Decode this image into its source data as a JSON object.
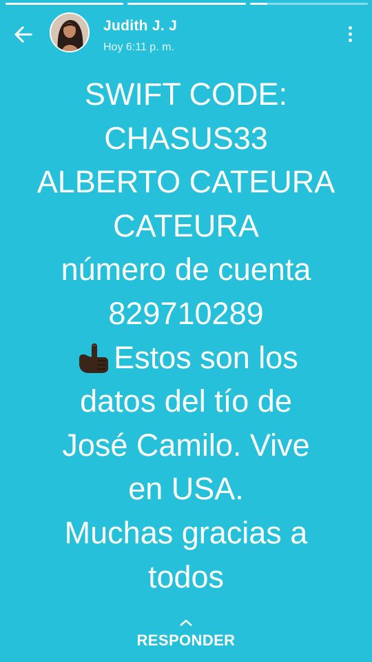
{
  "progress": {
    "segments": [
      1.0,
      1.0,
      0.15
    ]
  },
  "header": {
    "name": "Judith J. J",
    "time": "Hoy 6:11 p. m."
  },
  "message": {
    "lines": [
      "SWIFT CODE:",
      "CHASUS33",
      "ALBERTO CATEURA",
      "CATEURA",
      "número de cuenta",
      "829710289",
      "Estos son los",
      "datos del tío de",
      "José Camilo. Vive",
      "en USA.",
      "Muchas gracias a",
      "todos"
    ]
  },
  "footer": {
    "reply_label": "RESPONDER"
  },
  "colors": {
    "background": "#26c0da",
    "text": "#ffffff"
  },
  "icons": {
    "back": "arrow-left-icon",
    "menu": "more-vertical-icon",
    "emoji": "backhand-index-pointing-up-emoji",
    "reply": "chevron-up-icon"
  }
}
